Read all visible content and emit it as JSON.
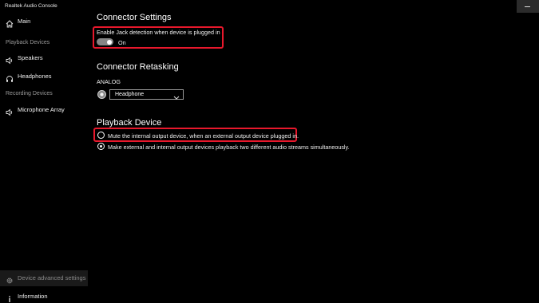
{
  "window": {
    "title": "Realtek Audio Console"
  },
  "sidebar": {
    "main_label": "Main",
    "playback_section": "Playback Devices",
    "speakers_label": "Speakers",
    "headphones_label": "Headphones",
    "recording_section": "Recording Devices",
    "microphone_label": "Microphone Array",
    "advanced_label": "Device advanced settings",
    "information_label": "Information"
  },
  "connector_settings": {
    "heading": "Connector Settings",
    "jack_detection_label": "Enable Jack detection when device is plugged in",
    "toggle_state": "On"
  },
  "connector_retasking": {
    "heading": "Connector Retasking",
    "analog_label": "ANALOG",
    "selected_device": "Headphone"
  },
  "playback_device": {
    "heading": "Playback Device",
    "option_mute": "Mute the internal output device, when an external output device plugged in.",
    "option_streams": "Make external and internal output devices playback two different audio streams simultaneously."
  },
  "colors": {
    "highlight": "#e8182c",
    "background": "#000000",
    "toggle": "#868686"
  }
}
